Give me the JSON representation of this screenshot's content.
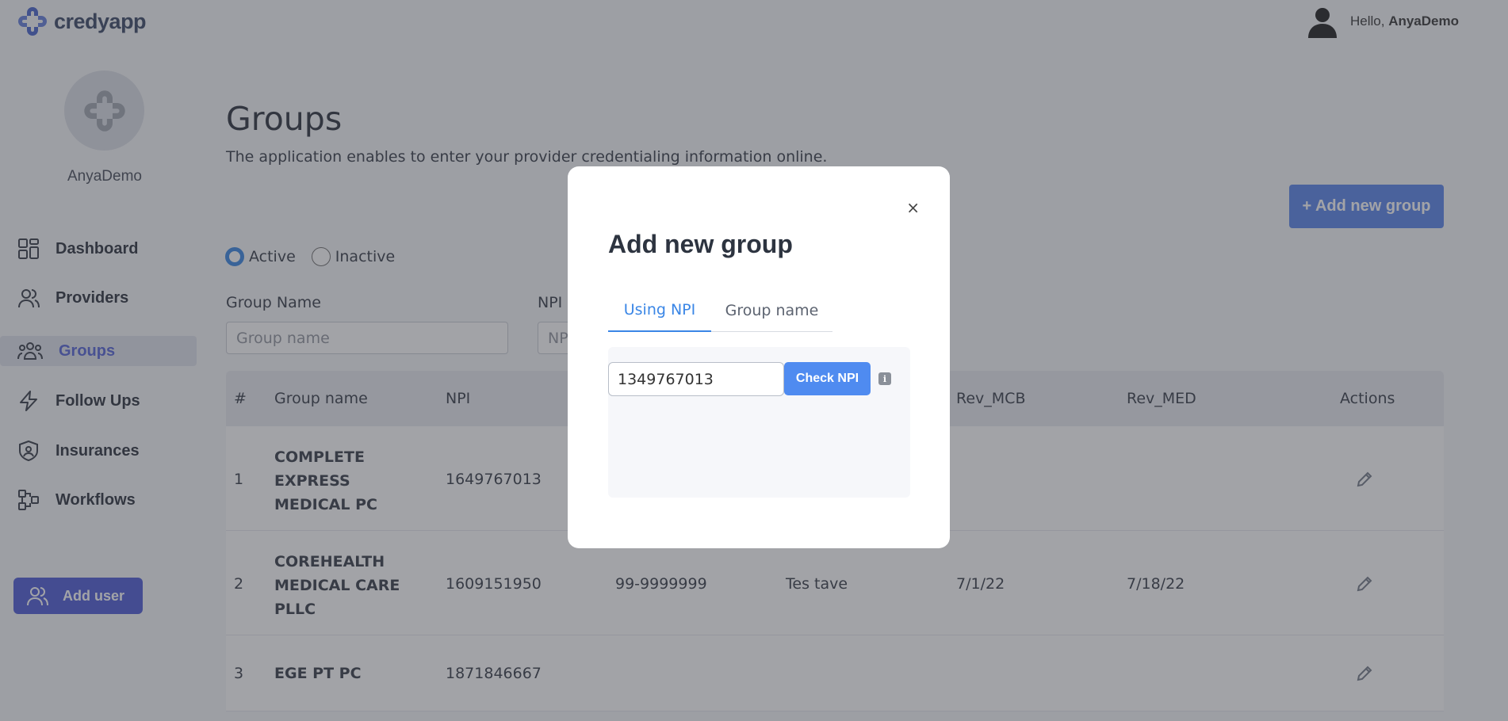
{
  "header": {
    "logo_text": "credyapp",
    "greeting": "Hello, ",
    "username": "AnyaDemo"
  },
  "sidebar": {
    "username": "AnyaDemo",
    "items": [
      {
        "label": "Dashboard",
        "icon": "grid-icon"
      },
      {
        "label": "Providers",
        "icon": "users-icon"
      },
      {
        "label": "Groups",
        "icon": "group-icon",
        "active": true
      },
      {
        "label": "Follow Ups",
        "icon": "lightning-icon"
      },
      {
        "label": "Insurances",
        "icon": "shield-icon"
      },
      {
        "label": "Workflows",
        "icon": "workflow-icon"
      }
    ],
    "add_user_label": "Add user"
  },
  "main": {
    "title": "Groups",
    "subtitle": "The application enables to enter your provider credentialing information online.",
    "add_group_label": "+ Add new group",
    "filters": {
      "status_active": "Active",
      "status_inactive": "Inactive",
      "selected": "Active",
      "group_name_label": "Group Name",
      "group_name_placeholder": "Group name",
      "npi_label": "NPI",
      "npi_placeholder": "NPI"
    },
    "table": {
      "columns": [
        "#",
        "Group name",
        "NPI",
        "",
        "",
        "Rev_MCB",
        "Rev_MED",
        "Actions"
      ],
      "rows": [
        {
          "num": "1",
          "name": "COMPLETE EXPRESS MEDICAL PC",
          "npi": "1649767013",
          "tax": "",
          "contact": "",
          "rev_mcb": "",
          "rev_med": ""
        },
        {
          "num": "2",
          "name": "COREHEALTH MEDICAL CARE PLLC",
          "npi": "1609151950",
          "tax": "99-9999999",
          "contact": "Tes tave",
          "rev_mcb": "7/1/22",
          "rev_med": "7/18/22"
        },
        {
          "num": "3",
          "name": "EGE PT PC",
          "npi": "1871846667",
          "tax": "",
          "contact": "",
          "rev_mcb": "",
          "rev_med": ""
        }
      ]
    }
  },
  "modal": {
    "title": "Add new group",
    "close_glyph": "×",
    "tabs": [
      "Using NPI",
      "Group name"
    ],
    "active_tab": "Using NPI",
    "npi_value": "1349767013",
    "check_label": "Check NPI",
    "info_glyph": "i"
  },
  "colors": {
    "primary": "#4351d2",
    "accent_blue": "#4f7de8",
    "tab_active": "#3a86e6",
    "overlay": "rgba(70,72,80,0.5)"
  }
}
